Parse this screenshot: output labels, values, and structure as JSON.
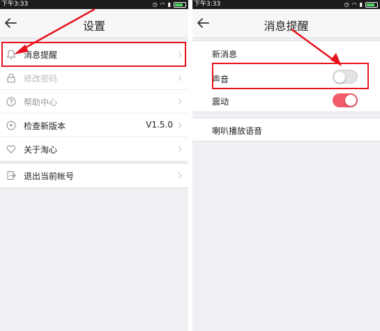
{
  "status_bar": {
    "time": "下午3:33"
  },
  "left": {
    "title": "设置",
    "items": [
      {
        "label": "消息提醒",
        "icon": "bell-icon"
      },
      {
        "label": "修改密码",
        "icon": "lock-icon"
      },
      {
        "label": "帮助中心",
        "icon": "help-icon"
      },
      {
        "label": "检查新版本",
        "value": "V1.5.0",
        "icon": "update-icon"
      },
      {
        "label": "关于淘心",
        "icon": "heart-icon"
      }
    ],
    "logout": {
      "label": "退出当前帐号",
      "icon": "logout-icon"
    }
  },
  "right": {
    "title": "消息提醒",
    "section_header": "新消息",
    "sound": {
      "label": "声音",
      "enabled": false
    },
    "vibrate": {
      "label": "震动",
      "enabled": true
    },
    "speaker": {
      "label": "喇叭播放语音"
    }
  },
  "colors": {
    "highlight": "#e8111c",
    "toggle_on": "#f45b69"
  }
}
